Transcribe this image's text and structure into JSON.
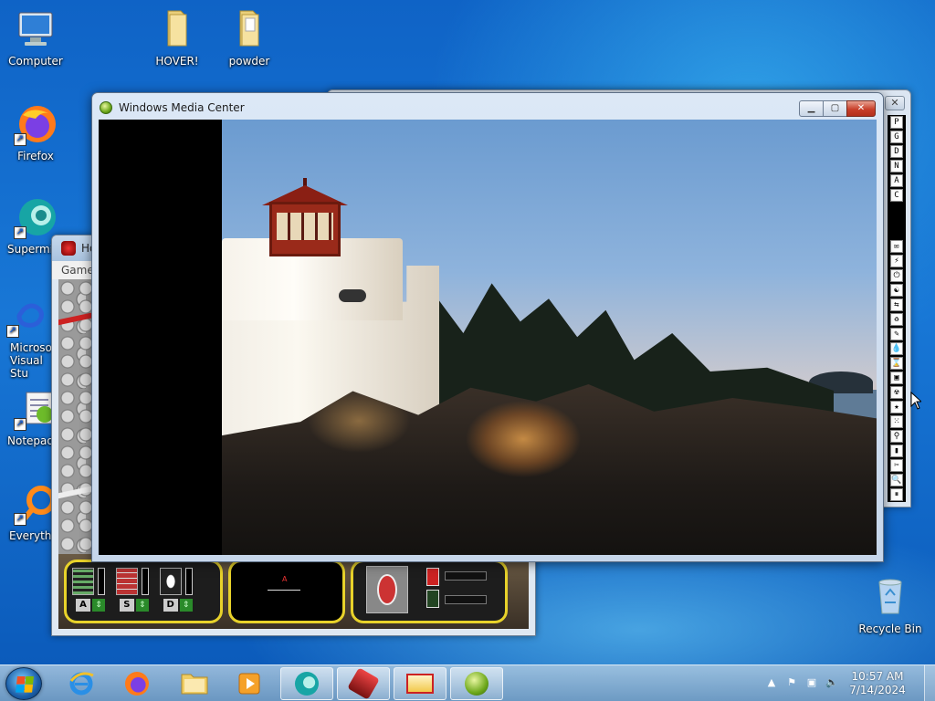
{
  "desktop": {
    "icons": [
      {
        "label": "Computer",
        "icon": "computer-icon"
      },
      {
        "label": "HOVER!",
        "icon": "folder-icon"
      },
      {
        "label": "powder",
        "icon": "folder-icon"
      },
      {
        "label": "Firefox",
        "icon": "firefox-icon"
      },
      {
        "label": "Supermi",
        "icon": "supermium-icon"
      },
      {
        "label": "Microso Visual Stu",
        "icon": "visual-studio-icon"
      },
      {
        "label": "Notepad",
        "icon": "notepad-icon"
      },
      {
        "label": "Everythi",
        "icon": "everything-search-icon"
      },
      {
        "label": "Recycle Bin",
        "icon": "recycle-bin-icon"
      }
    ]
  },
  "game_window": {
    "title": "Ho",
    "menu": "Game",
    "hud": {
      "keys": [
        "A",
        "S",
        "D"
      ],
      "radar_marker": "A"
    }
  },
  "side_window": {
    "close_label": "✕",
    "toolbar_buttons": [
      "P",
      "G",
      "D",
      "N",
      "A",
      "C"
    ],
    "toolbar_tools": [
      "✉",
      "⚡",
      "⏻",
      "☯",
      "⇆",
      "♻",
      "✎",
      "💧",
      "⌛",
      "▣",
      "☢",
      "★",
      "⁙",
      "⚲",
      "▮",
      "✂",
      "🔍",
      "⏸"
    ]
  },
  "wmc_window": {
    "title": "Windows Media Center",
    "buttons": {
      "minimize": "▁",
      "maximize": "▢",
      "close": "✕"
    },
    "content": "lighthouse-photo"
  },
  "taskbar": {
    "pinned": [
      "ie-icon",
      "firefox-icon",
      "explorer-icon",
      "media-player-icon"
    ],
    "running": [
      "supermium-icon",
      "hover-game-icon",
      "image-viewer-icon",
      "media-center-icon"
    ],
    "tray": {
      "time": "10:57 AM",
      "date": "7/14/2024"
    }
  },
  "colors": {
    "desktop_blue": "#1877d6",
    "wmc_close_red": "#c8402a",
    "hud_yellow": "#e8d22a"
  }
}
